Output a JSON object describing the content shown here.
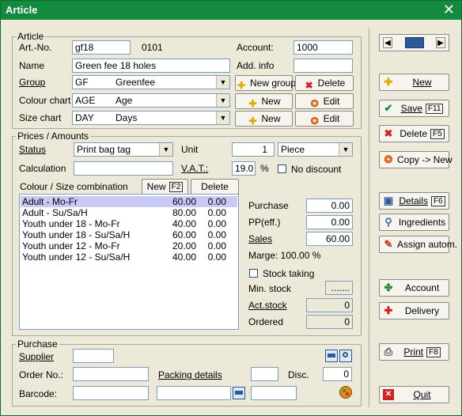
{
  "window": {
    "title": "Article",
    "close_glyph": "✕"
  },
  "article": {
    "legend": "Article",
    "artno_label": "Art.-No.",
    "artno_value": "gf18",
    "artno_code": "0101",
    "account_label": "Account:",
    "account_value": "1000",
    "name_label": "Name",
    "name_value": "Green fee 18 holes",
    "addinfo_label": "Add. info",
    "addinfo_value": "",
    "group_label": "Group",
    "group_code": "GF",
    "group_name": "Greenfee",
    "colour_label": "Colour chart",
    "colour_code": "AGE",
    "colour_name": "Age",
    "size_label": "Size chart",
    "size_code": "DAY",
    "size_name": "Days",
    "new_group_label": "New group",
    "delete_label": "Delete",
    "new_label": "New",
    "edit_label": "Edit"
  },
  "prices": {
    "legend": "Prices / Amounts",
    "status_label": "Status",
    "status_value": "Print bag tag",
    "unit_label": "Unit",
    "unit_qty": "1",
    "unit_value": "Piece",
    "calc_label": "Calculation",
    "calc_value": "",
    "vat_label": "V.A.T.:",
    "vat_value": "19.0",
    "vat_unit": "%",
    "nodiscount_label": "No discount",
    "combo_label": "Colour / Size combination",
    "combo_new_label": "New",
    "combo_new_key": "F2",
    "combo_delete_label": "Delete",
    "rows": [
      {
        "name": "Adult - Mo-Fr",
        "price": "60.00",
        "qty": "0.00"
      },
      {
        "name": "Adult - Su/Sa/H",
        "price": "80.00",
        "qty": "0.00"
      },
      {
        "name": "Youth under 18 - Mo-Fr",
        "price": "40.00",
        "qty": "0.00"
      },
      {
        "name": "Youth under 18 - Su/Sa/H",
        "price": "60.00",
        "qty": "0.00"
      },
      {
        "name": "Youth under 12 - Mo-Fr",
        "price": "20.00",
        "qty": "0.00"
      },
      {
        "name": "Youth under 12 - Su/Sa/H",
        "price": "40.00",
        "qty": "0.00"
      }
    ],
    "purchase_label": "Purchase",
    "purchase_value": "0.00",
    "pp_label": "PP(eff.)",
    "pp_value": "0.00",
    "sales_label": "Sales",
    "sales_value": "60.00",
    "marge_text": "Marge: 100.00 %",
    "stock_taking_label": "Stock taking",
    "min_stock_label": "Min. stock",
    "min_stock_value": ".......",
    "act_stock_label": "Act.stock",
    "act_stock_value": "0",
    "ordered_label": "Ordered",
    "ordered_value": "0"
  },
  "purchase": {
    "legend": "Purchase",
    "supplier_label": "Supplier",
    "supplier_value": "",
    "orderno_label": "Order No.:",
    "orderno_value": "",
    "packing_label": "Packing details",
    "packing_value": "",
    "disc_label": "Disc.",
    "disc_value": "0",
    "barcode_label": "Barcode:",
    "barcode_value": "",
    "barcode_value2": "",
    "barcode_value3": ""
  },
  "side": {
    "new": "New",
    "save": "Save",
    "save_key": "F11",
    "delete": "Delete",
    "delete_key": "F5",
    "copy": "Copy -> New",
    "details": "Details",
    "details_key": "F6",
    "ingredients": "Ingredients",
    "assign": "Assign autom.",
    "account": "Account",
    "delivery": "Delivery",
    "print": "Print",
    "print_key": "F8",
    "quit": "Quit"
  },
  "colors": {
    "title_bar": "#138a3e",
    "selection": "#c9c9f5",
    "face": "#ece9d8"
  }
}
